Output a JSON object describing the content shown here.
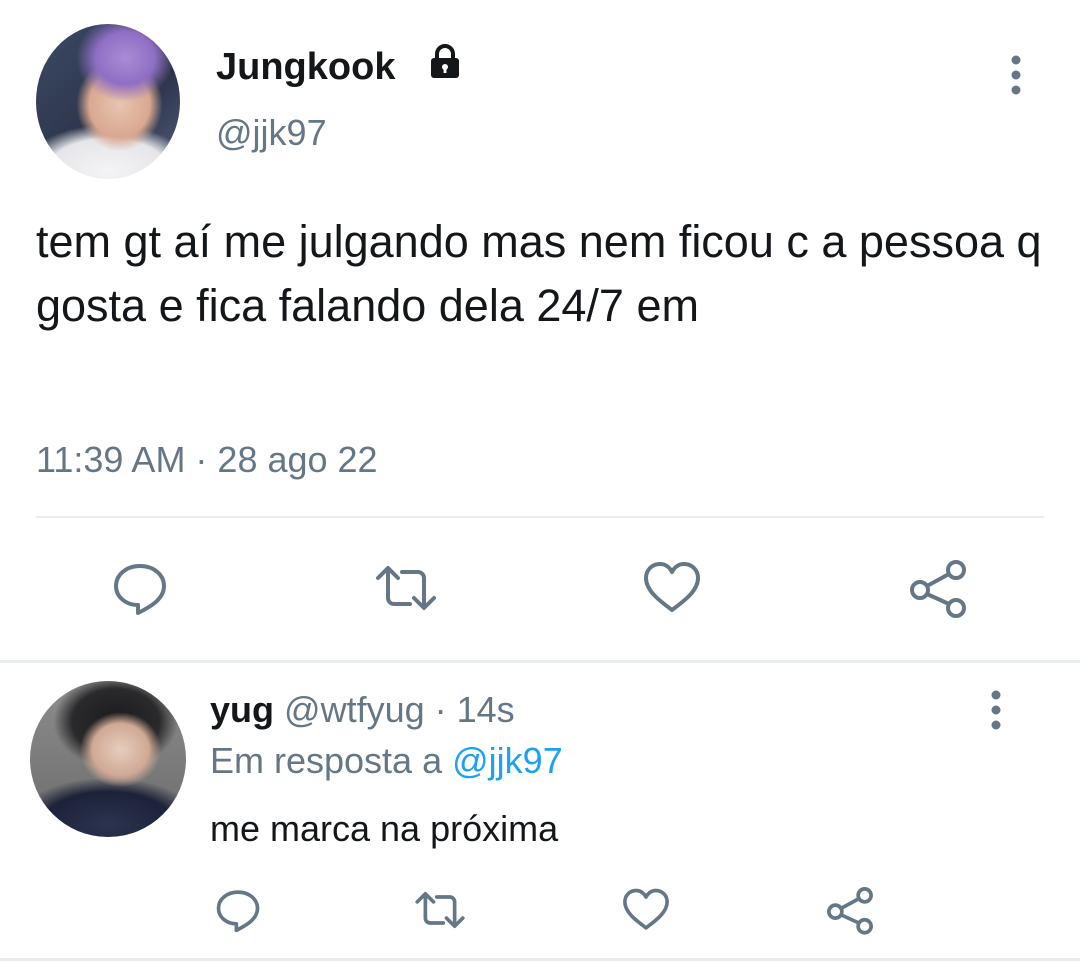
{
  "tweet": {
    "author_name": "Jungkook",
    "author_handle": "@jjk97",
    "text": "tem gt aí me julgando mas nem ficou c a pessoa q gosta e fica falando dela 24/7 em",
    "timestamp": "11:39 AM · 28 ago 22",
    "actions": [
      "reply-icon",
      "retweet-icon",
      "like-icon",
      "share-icon"
    ]
  },
  "reply": {
    "author_name": "yug",
    "author_handle": "@wtfyug",
    "age": "· 14s",
    "in_reply_prefix": "Em resposta a",
    "in_reply_mention": "@jjk97",
    "text": "me marca na próxima",
    "actions": [
      "reply-icon",
      "retweet-icon",
      "like-icon",
      "share-icon"
    ]
  },
  "colors": {
    "text": "#14171a",
    "secondary": "#657786",
    "link": "#1da1f2",
    "divider": "#e6ecf0"
  }
}
